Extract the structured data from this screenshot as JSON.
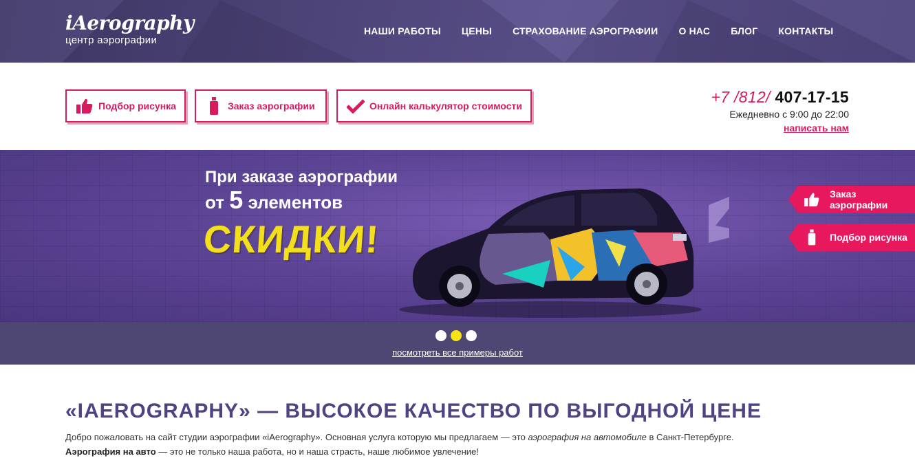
{
  "header": {
    "logo_title": "iAerography",
    "logo_subtitle": "центр аэрографии",
    "nav": [
      {
        "label": "НАШИ РАБОТЫ"
      },
      {
        "label": "ЦЕНЫ"
      },
      {
        "label": "СТРАХОВАНИЕ АЭРОГРАФИИ"
      },
      {
        "label": "О НАС"
      },
      {
        "label": "БЛОГ"
      },
      {
        "label": "КОНТАКТЫ"
      }
    ]
  },
  "actions": {
    "pick_design": "Подбор рисунка",
    "order_airbrush": "Заказ аэрографии",
    "calculator": "Онлайн калькулятор стоимости"
  },
  "contact": {
    "phone_code": "+7 /812/",
    "phone_number": "407-17-15",
    "hours": "Ежедневно с 9:00 до 22:00",
    "write_link": "написать нам"
  },
  "banner": {
    "line1": "При заказе аэрографии",
    "line2_prefix": "от",
    "line2_number": "5",
    "line2_suffix": "элементов",
    "sale": "СКИДКИ!",
    "side_tabs": {
      "order": "Заказ аэрографии",
      "pick": "Подбор рисунка"
    },
    "slides_total": 3,
    "active_slide": 2,
    "see_all": "посмотреть все примеры работ"
  },
  "content": {
    "title": "«IAEROGRAPHY» — ВЫСОКОЕ КАЧЕСТВО ПО ВЫГОДНОЙ ЦЕНЕ",
    "p1_start": "Добро пожаловать на сайт студии аэрографии «iAerography». Основная услуга которую мы предлагаем — это ",
    "p1_italic": "аэрография на автомобиле",
    "p1_end": " в Санкт-Петербурге.",
    "p2_bold": "Аэрография на авто",
    "p2_rest": " — это не только наша работа, но и наша страсть, наше любимое увлечение!"
  },
  "colors": {
    "accent": "#d81b60",
    "header_bg": "#4d4479",
    "banner_bg": "#5d4596",
    "sale_yellow": "#f3e01a",
    "title_purple": "#4d4483"
  },
  "icons": {
    "thumbs_up": "thumbs-up-icon",
    "spray_can": "spray-can-icon",
    "check": "check-icon"
  }
}
